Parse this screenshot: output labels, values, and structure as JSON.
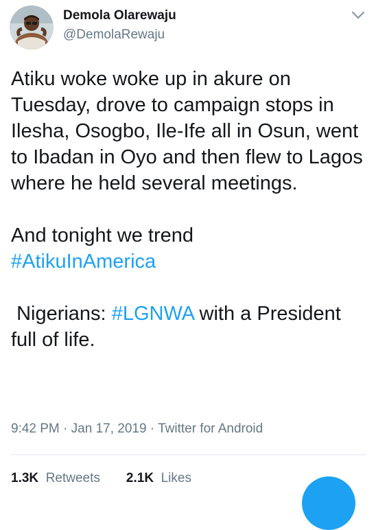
{
  "author": {
    "display_name": "Demola Olarewaju",
    "handle": "@DemolaRewaju",
    "avatar_icon": "profile-photo"
  },
  "tweet": {
    "paragraph_1": "Atiku woke woke up in akure on Tuesday, drove to campaign stops in Ilesha, Osogbo, Ile-Ife all in Osun, went to Ibadan in Oyo and then flew to Lagos where he held several meetings.",
    "paragraph_2_text": "And tonight we trend",
    "paragraph_2_hashtag": "#AtikuInAmerica",
    "paragraph_3_prefix": " Nigerians: ",
    "paragraph_3_hashtag": "#LGNWA",
    "paragraph_3_suffix": " with a President full of life."
  },
  "meta": {
    "time": "9:42 PM",
    "separator_1": " · ",
    "date": "Jan 17, 2019",
    "separator_2": " · ",
    "source": "Twitter for Android"
  },
  "stats": {
    "retweets_count": "1.3K",
    "retweets_label": "Retweets",
    "likes_count": "2.1K",
    "likes_label": "Likes"
  },
  "colors": {
    "link": "#1da1f2",
    "secondary_text": "#657786",
    "primary_text": "#14171a",
    "divider": "#e1e8ed"
  }
}
